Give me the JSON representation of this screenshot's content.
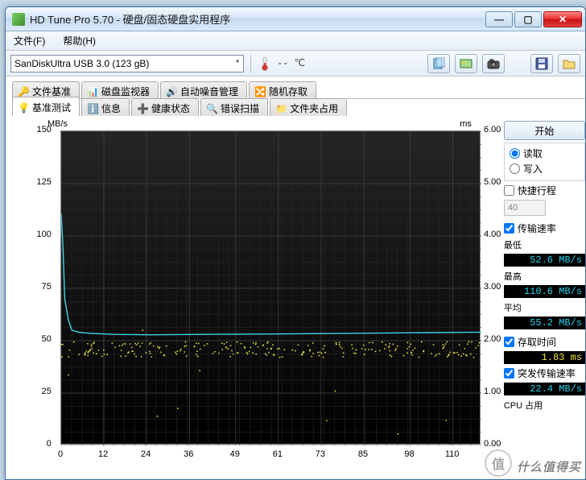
{
  "window": {
    "title": "HD Tune Pro 5.70 - 硬盘/固态硬盘实用程序"
  },
  "menu": {
    "file": "文件(F)",
    "help": "帮助(H)"
  },
  "toolbar": {
    "drive": "SanDiskUltra USB 3.0 (123 gB)",
    "temp": "-- ℃"
  },
  "tabs_row1": [
    {
      "label": "文件基准",
      "icon": "key"
    },
    {
      "label": "磁盘监视器",
      "icon": "chart"
    },
    {
      "label": "自动噪音管理",
      "icon": "speaker"
    },
    {
      "label": "随机存取",
      "icon": "shuffle"
    }
  ],
  "tabs_row2": [
    {
      "label": "基准测试",
      "icon": "bulb",
      "active": true
    },
    {
      "label": "信息",
      "icon": "info"
    },
    {
      "label": "健康状态",
      "icon": "health"
    },
    {
      "label": "错误扫描",
      "icon": "search"
    },
    {
      "label": "文件夹占用",
      "icon": "folder"
    }
  ],
  "side": {
    "start": "开始",
    "read": "读取",
    "write": "写入",
    "shortstroke": "快捷行程",
    "shortstroke_val": "40",
    "transfer_rate": "传输速率",
    "min_label": "最低",
    "min_val": "52.6 MB/s",
    "max_label": "最高",
    "max_val": "110.6 MB/s",
    "avg_label": "平均",
    "avg_val": "55.2 MB/s",
    "access_time": "存取时间",
    "access_val": "1.83 ms",
    "burst": "突发传输速率",
    "burst_val": "22.4 MB/s",
    "cpu_label": "CPU 占用"
  },
  "chart_data": {
    "type": "line+scatter",
    "xlabel": "",
    "y_left_label": "MB/s",
    "y_right_label": "ms",
    "x_ticks": [
      0,
      12,
      24,
      36,
      49,
      61,
      73,
      85,
      98,
      110
    ],
    "y_left_ticks": [
      0,
      25,
      50,
      75,
      100,
      125,
      150
    ],
    "y_right_ticks": [
      "0.00",
      "1.00",
      "2.00",
      "3.00",
      "4.00",
      "5.00",
      "6.00"
    ],
    "ylim_left": [
      0,
      150
    ],
    "ylim_right": [
      0,
      6
    ],
    "xlim": [
      0,
      118
    ],
    "series": [
      {
        "name": "transfer_speed",
        "color": "#3fd2e6",
        "type": "line",
        "x": [
          0,
          0.5,
          1,
          2,
          3,
          5,
          8,
          15,
          25,
          40,
          60,
          80,
          100,
          115,
          118
        ],
        "y": [
          110.6,
          95,
          70,
          60,
          55,
          54,
          53.5,
          53,
          52.8,
          53,
          53.2,
          53.5,
          53.8,
          54,
          54
        ]
      },
      {
        "name": "access_time",
        "color": "#e6e23f",
        "type": "scatter",
        "mean_ms": 1.83,
        "spread_ms": [
          0.2,
          2.2
        ],
        "x_range": [
          0,
          118
        ],
        "approx_points": 250
      }
    ]
  },
  "watermark": "什么值得买"
}
